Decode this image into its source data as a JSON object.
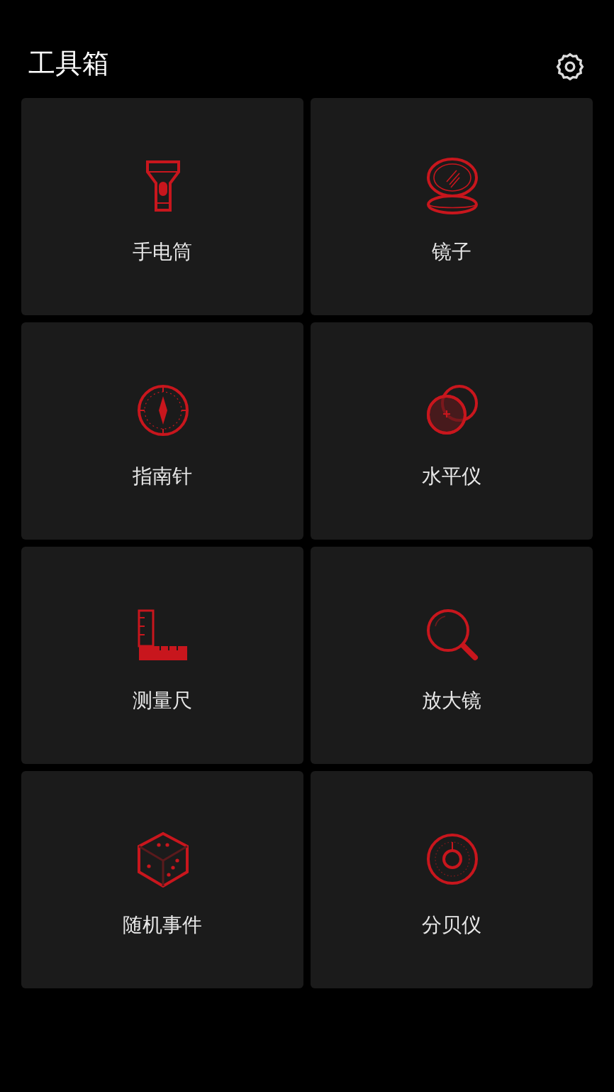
{
  "header": {
    "title": "工具箱"
  },
  "tools": [
    {
      "kind": "flashlight",
      "label": "手电筒"
    },
    {
      "kind": "mirror",
      "label": "镜子"
    },
    {
      "kind": "compass",
      "label": "指南针"
    },
    {
      "kind": "level",
      "label": "水平仪"
    },
    {
      "kind": "ruler",
      "label": "测量尺"
    },
    {
      "kind": "magnifier",
      "label": "放大镜"
    },
    {
      "kind": "dice",
      "label": "随机事件"
    },
    {
      "kind": "decibel",
      "label": "分贝仪"
    }
  ]
}
